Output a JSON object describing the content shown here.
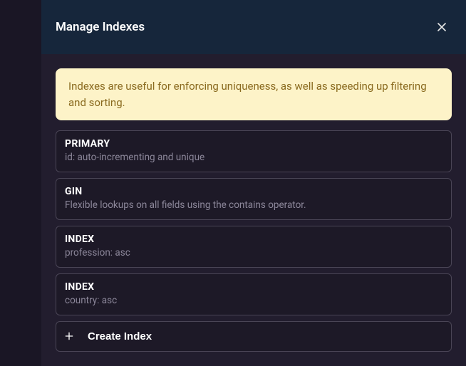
{
  "header": {
    "title": "Manage Indexes"
  },
  "info": {
    "text": "Indexes are useful for enforcing uniqueness, as well as speeding up filtering and sorting."
  },
  "indexes": [
    {
      "name": "PRIMARY",
      "description": "id: auto-incrementing and unique"
    },
    {
      "name": "GIN",
      "description": "Flexible lookups on all fields using the contains operator."
    },
    {
      "name": "INDEX",
      "description": "profession: asc"
    },
    {
      "name": "INDEX",
      "description": "country: asc"
    }
  ],
  "actions": {
    "create_label": "Create Index"
  }
}
